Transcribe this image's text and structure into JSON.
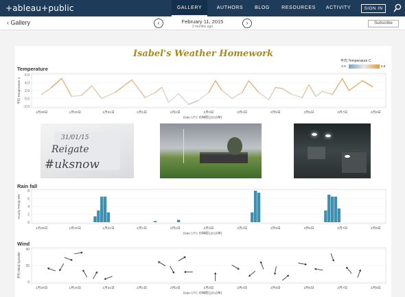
{
  "header": {
    "logo": "+ableau+public",
    "nav": [
      "GALLERY",
      "AUTHORS",
      "BLOG",
      "RESOURCES",
      "ACTIVITY"
    ],
    "active_tab": "GALLERY",
    "sign_in": "SIGN IN"
  },
  "subbar": {
    "back": "Gallery",
    "date": "February 11, 2015",
    "ago": "3 months ago",
    "subscribe": "Subscribe"
  },
  "viz": {
    "title": "Isabel's Weather Homework",
    "legend": {
      "title": "平均 Temperature C",
      "min": "-2.9",
      "max": "5.8",
      "low_color": "#7aa6c2",
      "high_color": "#e09a3c"
    },
    "sections": {
      "temperature": "Temperature",
      "rain": "Rain fall",
      "wind": "Wind"
    },
    "x_label": "Date UTC の時間 [2015年]",
    "x_ticks": [
      "1月29日",
      "1月30日",
      "1月31日",
      "2月1日",
      "2月2日",
      "2月3日",
      "2月4日",
      "2月5日",
      "2月6日",
      "2月7日",
      "2月8日"
    ],
    "photos": [
      "snow writing on car: 31/01/15 Reigate #uksnow",
      "grey sky over field and building",
      "cars on a rainy road at night"
    ]
  },
  "chart_data": [
    {
      "type": "line",
      "title": "Temperature",
      "ylabel": "平均 Temperature C",
      "ylim": [
        -2,
        6
      ],
      "y_ticks": [
        "6.0",
        "4.0",
        "2.0",
        "0.0",
        "-2.0"
      ],
      "x": [
        0,
        0.3,
        0.6,
        0.9,
        1.2,
        1.5,
        1.8,
        2.2,
        2.7,
        3.1,
        3.4,
        3.6,
        3.8,
        4.1,
        4.4,
        4.7,
        5.0,
        5.2,
        5.4,
        5.7,
        6.0,
        6.2,
        6.5,
        6.8,
        7.0,
        7.2,
        7.5,
        7.8,
        8.0,
        8.2,
        8.4,
        8.7,
        9.0,
        9.2,
        9.6,
        9.9
      ],
      "values": [
        1.0,
        2.8,
        5.1,
        0.5,
        0.8,
        3.2,
        0.0,
        1.5,
        4.7,
        0.2,
        1.5,
        2.8,
        -1.0,
        1.2,
        -1.5,
        -0.5,
        1.5,
        4.5,
        2.0,
        0.0,
        1.5,
        4.5,
        1.5,
        -0.3,
        2.8,
        2.5,
        1.0,
        0.2,
        3.5,
        0.5,
        1.8,
        1.0,
        5.0,
        2.0,
        4.5,
        3.0
      ]
    },
    {
      "type": "bar",
      "title": "Rain fall",
      "ylabel": "Hourly Precip MM",
      "ylim": [
        0,
        8
      ],
      "y_ticks": [
        "8",
        "6",
        "4",
        "2",
        "0"
      ],
      "x": [
        1.6,
        1.7,
        1.8,
        1.9,
        2.0,
        3.4,
        4.1,
        6.3,
        6.4,
        6.5,
        8.5,
        8.6,
        8.7,
        8.8,
        8.9
      ],
      "values": [
        1.5,
        3.0,
        6.5,
        6.5,
        2.5,
        0.3,
        0.6,
        2.5,
        8.0,
        7.5,
        3.0,
        7.0,
        6.5,
        6.5,
        3.5
      ]
    },
    {
      "type": "scatter",
      "title": "Wind",
      "ylabel": "平均 Wind SpeedM",
      "ylim": [
        0,
        40
      ],
      "y_ticks": [
        "40",
        "20",
        "0"
      ],
      "x": [
        0.3,
        0.6,
        0.8,
        1.1,
        1.3,
        1.6,
        2.0,
        3.6,
        3.9,
        4.2,
        4.4,
        5.2,
        5.8,
        6.3,
        6.6,
        7.0,
        7.3,
        7.8,
        8.3,
        8.7,
        9.2,
        9.5
      ],
      "values": [
        15,
        18,
        28,
        35,
        10,
        8,
        5,
        22,
        15,
        28,
        12,
        6,
        18,
        10,
        20,
        14,
        5,
        22,
        15,
        30,
        14,
        10
      ]
    }
  ]
}
